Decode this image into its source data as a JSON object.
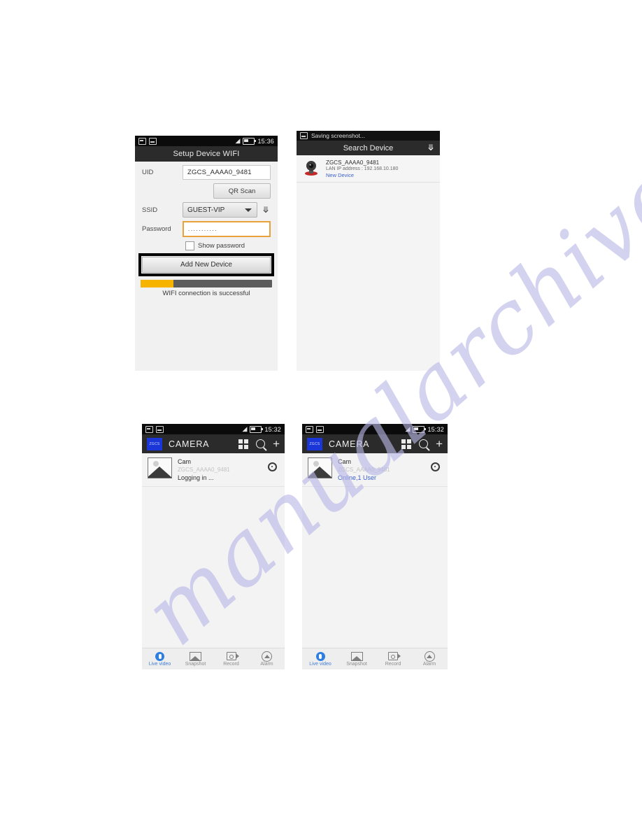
{
  "panels": {
    "setup": {
      "statusbar": {
        "time": "15:36",
        "icons": [
          "sim-card-icon",
          "screenshot-icon",
          "wifi-icon",
          "battery-icon"
        ]
      },
      "title": "Setup Device WIFI",
      "uid": {
        "label": "UID",
        "value": "ZGCS_AAAA0_9481"
      },
      "qr_scan": "QR Scan",
      "ssid": {
        "label": "SSID",
        "value": "GUEST-VIP"
      },
      "password": {
        "label": "Password",
        "value": "..........."
      },
      "show_password": "Show password",
      "add_new_device": "Add New Device",
      "progress": {
        "percent": 25,
        "text": "WIFI connection is successful",
        "fill_color": "#f6b400",
        "track_color": "#5c5c5c"
      }
    },
    "search": {
      "toast": "Saving screenshot...",
      "title": "Search Device",
      "device": {
        "uid": "ZGCS_AAAA0_9481",
        "ip": "LAN IP address : 192.168.10.180",
        "state": "New Device",
        "state_color": "#3a5fcd"
      }
    },
    "camera_a": {
      "statusbar": {
        "time": "15:32"
      },
      "app_logo": "ZGCS",
      "app_title": "CAMERA",
      "device": {
        "name": "Cam",
        "uid": "ZGCS_AAAA0_9481",
        "status": "Logging in ...",
        "status_color": "#333333"
      },
      "tabs": [
        {
          "label": "Live video",
          "icon": "live-video-icon",
          "active": true
        },
        {
          "label": "Snapshot",
          "icon": "snapshot-icon",
          "active": false
        },
        {
          "label": "Record",
          "icon": "record-icon",
          "active": false
        },
        {
          "label": "Alarm",
          "icon": "alarm-icon",
          "active": false
        }
      ]
    },
    "camera_b": {
      "statusbar": {
        "time": "15:32"
      },
      "app_logo": "ZGCS",
      "app_title": "CAMERA",
      "device": {
        "name": "Cam",
        "uid": "ZGCS_AAAA0_9481",
        "status": "Online,1 User",
        "status_color": "#3a5fcd"
      },
      "tabs": [
        {
          "label": "Live video",
          "icon": "live-video-icon",
          "active": true
        },
        {
          "label": "Snapshot",
          "icon": "snapshot-icon",
          "active": false
        },
        {
          "label": "Record",
          "icon": "record-icon",
          "active": false
        },
        {
          "label": "Alarm",
          "icon": "alarm-icon",
          "active": false
        }
      ]
    }
  },
  "watermark": {
    "text": "manualarchive.com",
    "color": "#b9b9e8"
  }
}
